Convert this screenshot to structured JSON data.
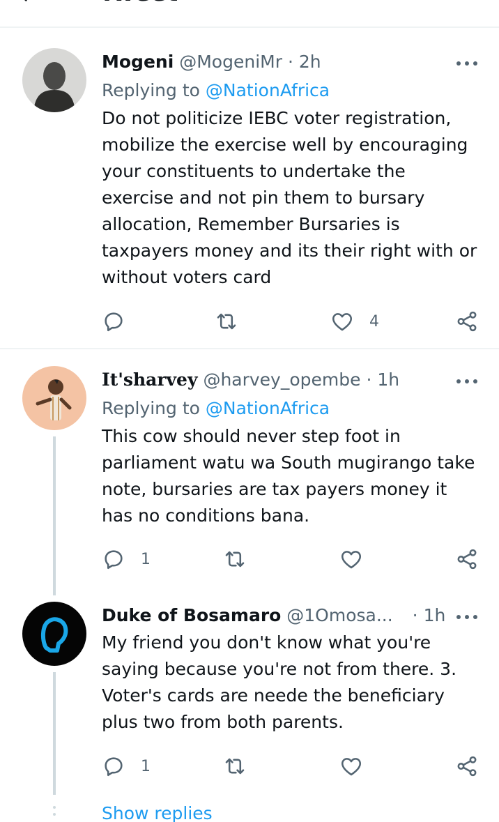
{
  "header": {
    "title": "Tweet",
    "back_icon": "arrow-left-icon"
  },
  "colors": {
    "accent": "#1d9bf0",
    "secondary_text": "#536471",
    "primary_text": "#0f1419",
    "divider": "#eff3f4",
    "thread_line": "#cfd9de"
  },
  "tweets": [
    {
      "name": "Mogeni",
      "handle": "@MogeniMr",
      "sep": "·",
      "time": "2h",
      "replying_prefix": "Replying to",
      "replying_to": "@NationAfrica",
      "text": "Do not politicize IEBC voter registration, mobilize the exercise well by encouraging your constituents to undertake the exercise and not pin them to bursary allocation, Remember Bursaries is taxpayers money and its their right with or without voters card",
      "reply_count": "",
      "retweet_count": "",
      "like_count": "4"
    },
    {
      "name": "It'sharvey",
      "handle": "@harvey_opembe",
      "sep": "·",
      "time": "1h",
      "replying_prefix": "Replying to",
      "replying_to": "@NationAfrica",
      "text": "This cow should never step foot in parliament watu wa South mugirango take note, bursaries are tax payers money it has no conditions bana.",
      "reply_count": "1",
      "retweet_count": "",
      "like_count": ""
    },
    {
      "name": "Duke of Bosamaro",
      "handle": "@1Omosa...",
      "sep": "·",
      "time": "1h",
      "text": "My friend you don't know what you're saying because you're not from there. 3. Voter's cards are neede the beneficiary plus two from both parents.",
      "reply_count": "1",
      "retweet_count": "",
      "like_count": ""
    }
  ],
  "show_replies": "Show replies"
}
